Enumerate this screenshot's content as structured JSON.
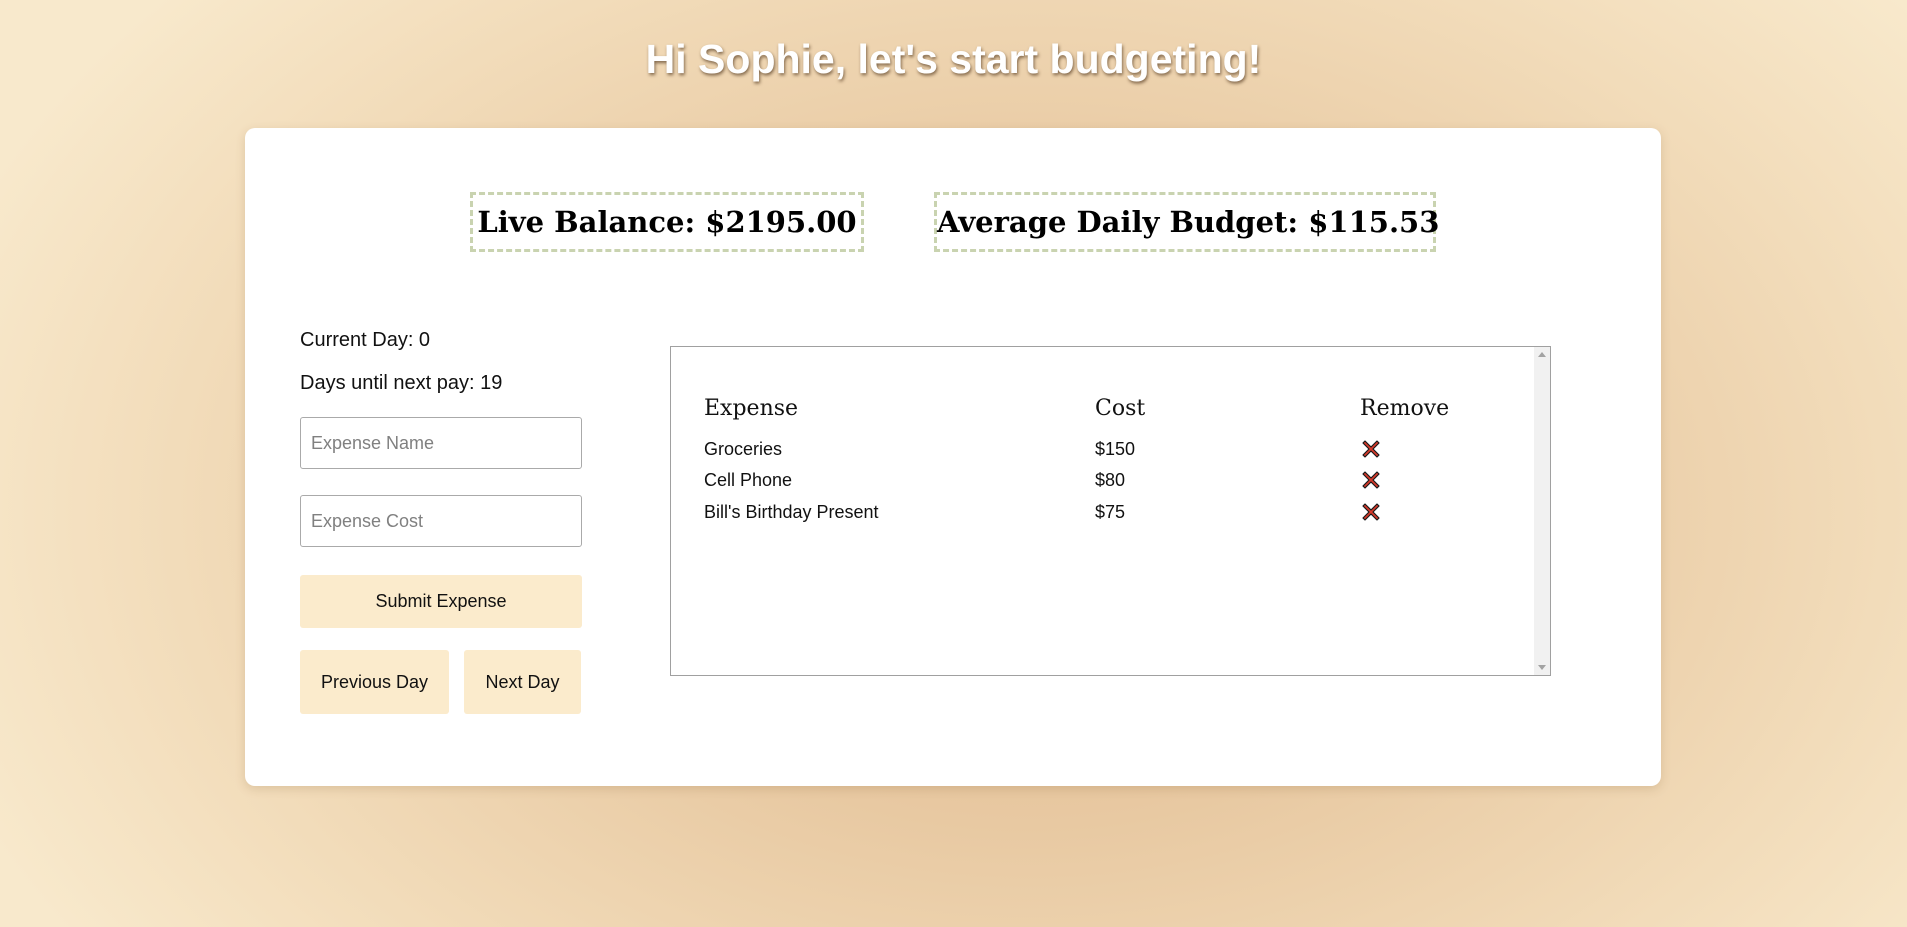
{
  "header": {
    "title": "Hi Sophie, let's start budgeting!"
  },
  "summary": {
    "live_balance": "Live Balance: $2195.00",
    "average_daily_budget": "Average Daily Budget: $115.53"
  },
  "status": {
    "current_day": "Current Day: 0",
    "days_until_pay": "Days until next pay: 19"
  },
  "form": {
    "expense_name_placeholder": "Expense Name",
    "expense_name_value": "",
    "expense_cost_placeholder": "Expense Cost",
    "expense_cost_value": "",
    "submit_label": "Submit Expense",
    "previous_day_label": "Previous Day",
    "next_day_label": "Next Day"
  },
  "table": {
    "headers": [
      "Expense",
      "Cost",
      "Remove"
    ],
    "rows": [
      {
        "name": "Groceries",
        "cost": "$150",
        "remove_icon": "red-x-icon"
      },
      {
        "name": "Cell Phone",
        "cost": "$80",
        "remove_icon": "red-x-icon"
      },
      {
        "name": "Bill's Birthday Present",
        "cost": "$75",
        "remove_icon": "red-x-icon"
      }
    ]
  },
  "colors": {
    "button_background": "#fbebcc",
    "summary_border": "#c9d3b0",
    "remove_icon": "#d83a2b"
  }
}
